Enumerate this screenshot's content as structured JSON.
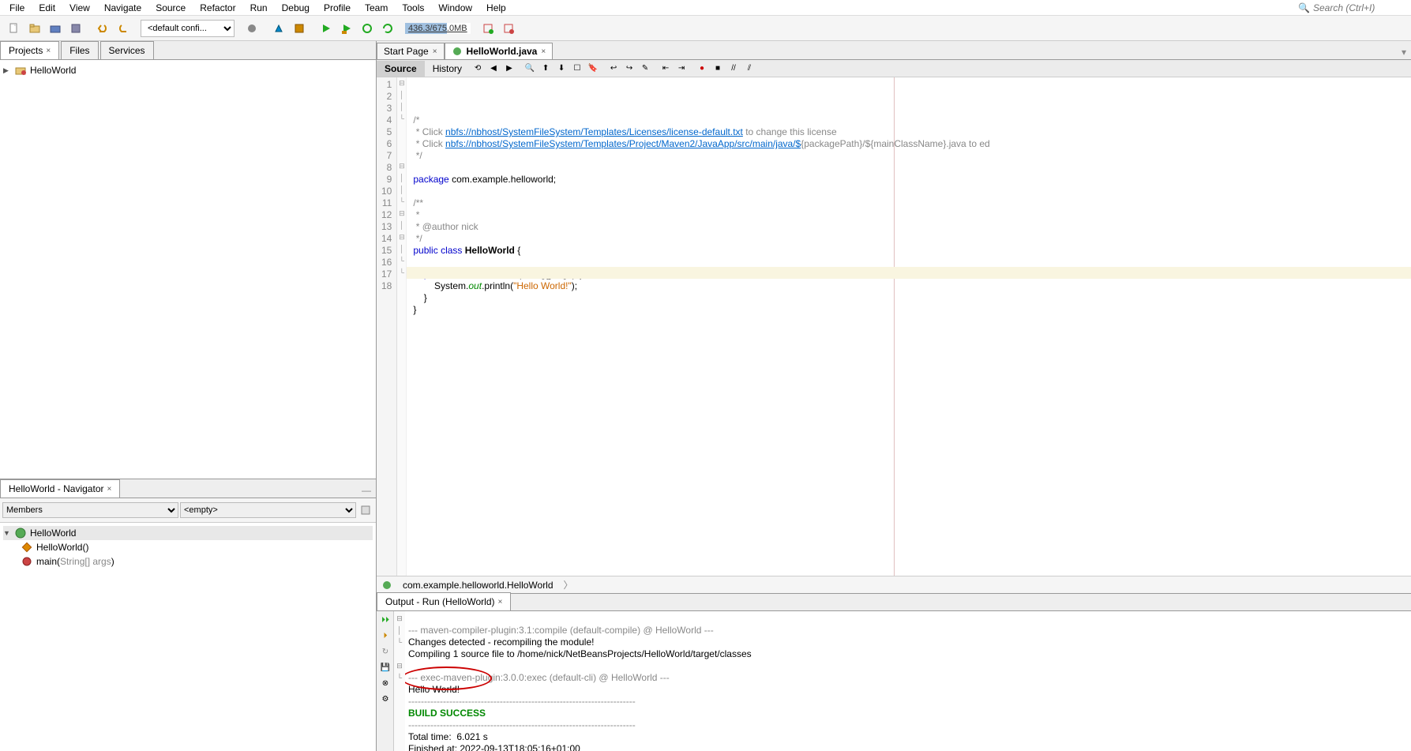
{
  "menu": [
    "File",
    "Edit",
    "View",
    "Navigate",
    "Source",
    "Refactor",
    "Run",
    "Debug",
    "Profile",
    "Team",
    "Tools",
    "Window",
    "Help"
  ],
  "search_placeholder": "Search (Ctrl+I)",
  "config_combo": "<default confi...",
  "memory": "436.3/675.0MB",
  "left_tabs": [
    "Projects",
    "Files",
    "Services"
  ],
  "project_tree_root": "HelloWorld",
  "navigator": {
    "title": "HelloWorld - Navigator",
    "filter1": "Members",
    "filter2": "<empty>",
    "nodes": [
      "HelloWorld",
      "HelloWorld()",
      "main(String[] args)"
    ]
  },
  "editor_tabs": [
    {
      "label": "Start Page",
      "active": false
    },
    {
      "label": "HelloWorld.java",
      "active": true,
      "icon": "java"
    }
  ],
  "editor_sub_tabs": [
    "Source",
    "History"
  ],
  "code": {
    "lines": [
      "/*",
      " * Click nbfs://nbhost/SystemFileSystem/Templates/Licenses/license-default.txt to change this license",
      " * Click nbfs://nbhost/SystemFileSystem/Templates/Project/Maven2/JavaApp/src/main/java/${packagePath}/${mainClassName}.java to ed",
      " */",
      "",
      "package com.example.helloworld;",
      "",
      "/**",
      " *",
      " * @author nick",
      " */",
      "public class HelloWorld {",
      "",
      "    public static void main(String[] args) {",
      "        System.out.println(\"Hello World!\");",
      "    }",
      "}",
      ""
    ],
    "url1": "nbfs://nbhost/SystemFileSystem/Templates/Licenses/license-default.txt",
    "url2": "nbfs://nbhost/SystemFileSystem/Templates/Project/Maven2/JavaApp/src/main/java/$"
  },
  "breadcrumb": "com.example.helloworld.HelloWorld",
  "output": {
    "tab": "Output - Run (HelloWorld)",
    "lines": [
      {
        "t": "--- maven-compiler-plugin:3.1:compile (default-compile) @ HelloWorld ---",
        "c": "grey"
      },
      {
        "t": "Changes detected - recompiling the module!",
        "c": ""
      },
      {
        "t": "Compiling 1 source file to /home/nick/NetBeansProjects/HelloWorld/target/classes",
        "c": ""
      },
      {
        "t": "",
        "c": ""
      },
      {
        "t": "--- exec-maven-plugin:3.0.0:exec (default-cli) @ HelloWorld ---",
        "c": "grey"
      },
      {
        "t": "Hello World!",
        "c": ""
      },
      {
        "t": "------------------------------------------------------------------------",
        "c": "grey"
      },
      {
        "t": "BUILD SUCCESS",
        "c": "green"
      },
      {
        "t": "------------------------------------------------------------------------",
        "c": "grey"
      },
      {
        "t": "Total time:  6.021 s",
        "c": ""
      },
      {
        "t": "Finished at: 2022-09-13T18:05:16+01:00",
        "c": ""
      }
    ]
  }
}
